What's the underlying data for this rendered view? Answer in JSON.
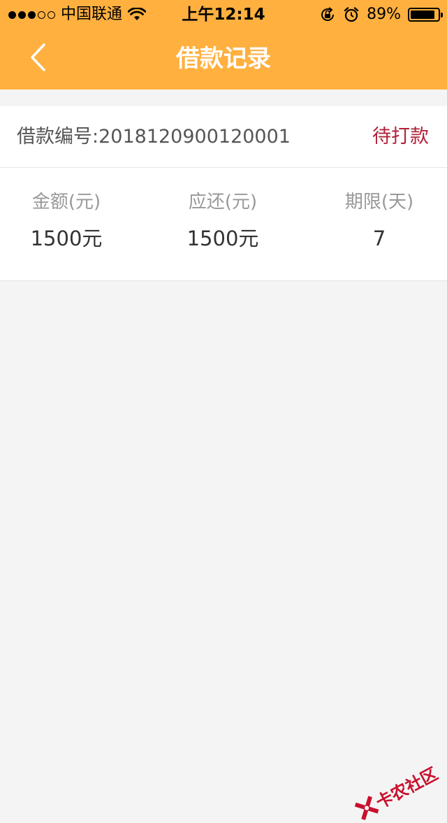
{
  "status_bar": {
    "signal_dots_filled": 3,
    "signal_dots_total": 5,
    "carrier": "中国联通",
    "time": "上午12:14",
    "battery_percent": "89%",
    "battery_level": 0.89,
    "icons": [
      "wifi-icon",
      "orientation-lock-icon",
      "alarm-icon",
      "battery-icon"
    ]
  },
  "nav": {
    "back_icon": "chevron-left-icon",
    "title": "借款记录"
  },
  "loan_record": {
    "number_label": "借款编号:",
    "number": "2018120900120001",
    "status": "待打款",
    "stats": [
      {
        "label": "金额(元)",
        "value": "1500元"
      },
      {
        "label": "应还(元)",
        "value": "1500元"
      },
      {
        "label": "期限(天)",
        "value": "7"
      }
    ]
  },
  "watermark": {
    "text": "卡农社区"
  },
  "colors": {
    "header_bg": "#FFB03F",
    "status_red": "#b0233a",
    "page_bg": "#f4f4f4"
  }
}
